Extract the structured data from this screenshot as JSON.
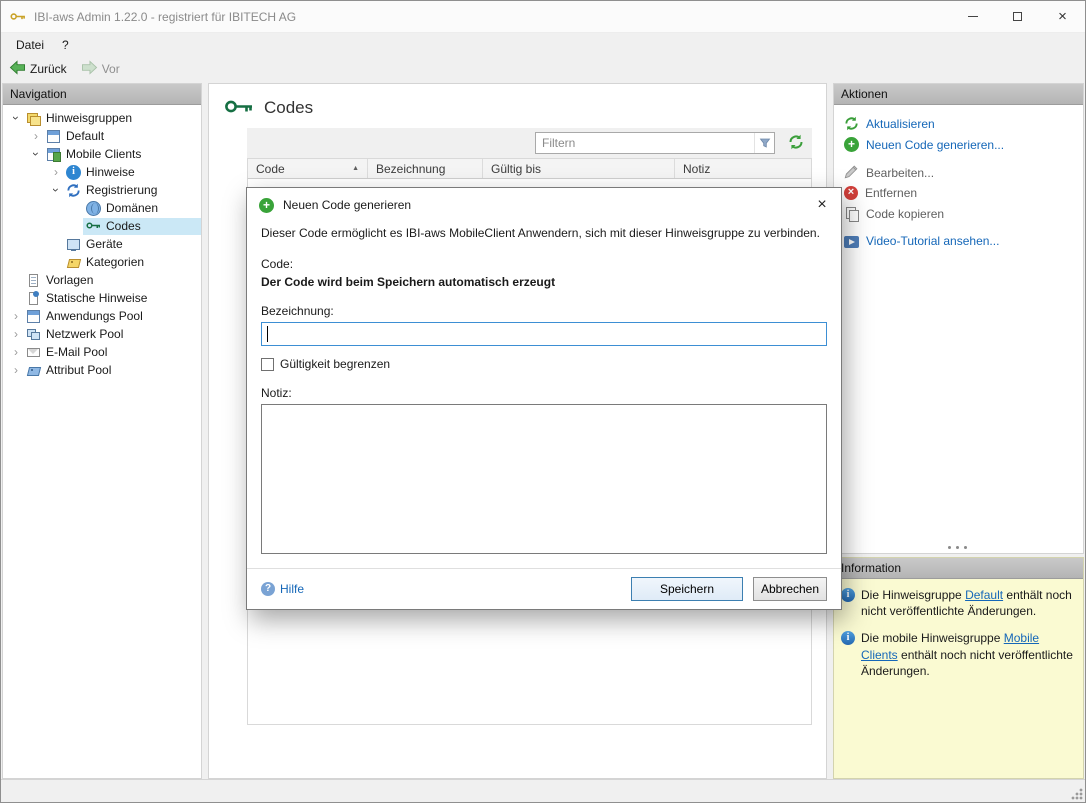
{
  "window": {
    "title": "IBI-aws Admin 1.22.0 - registriert für IBITECH AG",
    "controls": [
      "minimize-icon",
      "maximize-icon",
      "close-icon"
    ]
  },
  "menu": {
    "items": [
      {
        "label": "Datei"
      },
      {
        "label": "?"
      }
    ]
  },
  "toolbar": {
    "back_label": "Zurück",
    "forward_label": "Vor"
  },
  "nav": {
    "header": "Navigation",
    "items": [
      {
        "label": "Hinweisgruppen",
        "depth": 0,
        "chevron": "expanded",
        "icon": "group-icon",
        "selected": false
      },
      {
        "label": "Default",
        "depth": 1,
        "chevron": "collapsed",
        "icon": "notice-group-icon",
        "selected": false
      },
      {
        "label": "Mobile Clients",
        "depth": 1,
        "chevron": "expanded",
        "icon": "mobile-group-icon",
        "selected": false
      },
      {
        "label": "Hinweise",
        "depth": 2,
        "chevron": "collapsed",
        "icon": "notices-icon",
        "selected": false
      },
      {
        "label": "Registrierung",
        "depth": 2,
        "chevron": "expanded",
        "icon": "registration-icon",
        "selected": false
      },
      {
        "label": "Domänen",
        "depth": 3,
        "chevron": "none",
        "icon": "domains-icon",
        "selected": false
      },
      {
        "label": "Codes",
        "depth": 3,
        "chevron": "none",
        "icon": "key-icon",
        "selected": true
      },
      {
        "label": "Geräte",
        "depth": 2,
        "chevron": "none",
        "icon": "devices-icon",
        "selected": false
      },
      {
        "label": "Kategorien",
        "depth": 2,
        "chevron": "none",
        "icon": "categories-icon",
        "selected": false
      },
      {
        "label": "Vorlagen",
        "depth": 0,
        "chevron": "none",
        "icon": "templates-icon",
        "selected": false
      },
      {
        "label": "Statische Hinweise",
        "depth": 0,
        "chevron": "none",
        "icon": "static-notices-icon",
        "selected": false
      },
      {
        "label": "Anwendungs Pool",
        "depth": 0,
        "chevron": "collapsed",
        "icon": "applications-pool-icon",
        "selected": false
      },
      {
        "label": "Netzwerk Pool",
        "depth": 0,
        "chevron": "collapsed",
        "icon": "network-pool-icon",
        "selected": false
      },
      {
        "label": "E-Mail Pool",
        "depth": 0,
        "chevron": "collapsed",
        "icon": "email-pool-icon",
        "selected": false
      },
      {
        "label": "Attribut Pool",
        "depth": 0,
        "chevron": "collapsed",
        "icon": "attribute-pool-icon",
        "selected": false
      }
    ]
  },
  "main": {
    "title": "Codes",
    "title_icon": "key-icon",
    "filter_placeholder": "Filtern",
    "filter_value": "",
    "refresh_icon": "refresh-icon",
    "columns": [
      "Code",
      "Bezeichnung",
      "Gültig bis",
      "Notiz"
    ],
    "sorted_column": "Code",
    "sort_direction": "ascending",
    "rows": []
  },
  "actions": {
    "header": "Aktionen",
    "items": [
      {
        "label": "Aktualisieren",
        "icon": "refresh-icon",
        "enabled": true
      },
      {
        "label": "Neuen Code generieren...",
        "icon": "add-icon",
        "enabled": true
      },
      {
        "label": "Bearbeiten...",
        "icon": "edit-icon",
        "enabled": false
      },
      {
        "label": "Entfernen",
        "icon": "remove-icon",
        "enabled": false
      },
      {
        "label": "Code kopieren",
        "icon": "copy-icon",
        "enabled": false
      },
      {
        "label": "Video-Tutorial ansehen...",
        "icon": "video-icon",
        "enabled": true
      }
    ]
  },
  "information": {
    "header": "Information",
    "items": [
      {
        "icon": "info-icon",
        "prefix": "Die Hinweisgruppe ",
        "link": "Default",
        "suffix": " enthält noch nicht veröffentlichte Änderungen."
      },
      {
        "icon": "info-icon",
        "prefix": "Die mobile Hinweisgruppe ",
        "link": "Mobile Clients",
        "suffix": " enthält noch nicht veröffentlichte Änderungen."
      }
    ]
  },
  "dialog": {
    "title": "Neuen Code generieren",
    "title_icon": "add-icon",
    "close_icon": "close-icon",
    "description": "Dieser Code ermöglicht es IBI-aws MobileClient Anwendern, sich mit dieser Hinweisgruppe zu verbinden.",
    "code_label": "Code:",
    "code_value": "Der Code wird beim Speichern automatisch erzeugt",
    "bezeichnung_label": "Bezeichnung:",
    "bezeichnung_value": "",
    "checkbox_label": "Gültigkeit begrenzen",
    "checkbox_checked": false,
    "notiz_label": "Notiz:",
    "notiz_value": "",
    "help_label": "Hilfe",
    "save_label": "Speichern",
    "cancel_label": "Abbrechen"
  },
  "colors": {
    "accent_blue": "#3d8fd4",
    "link_blue": "#1567b8",
    "selection_blue": "#cbe8f6",
    "info_panel_yellow": "#fafad2",
    "key_green": "#166f43",
    "action_green": "#39a339"
  }
}
